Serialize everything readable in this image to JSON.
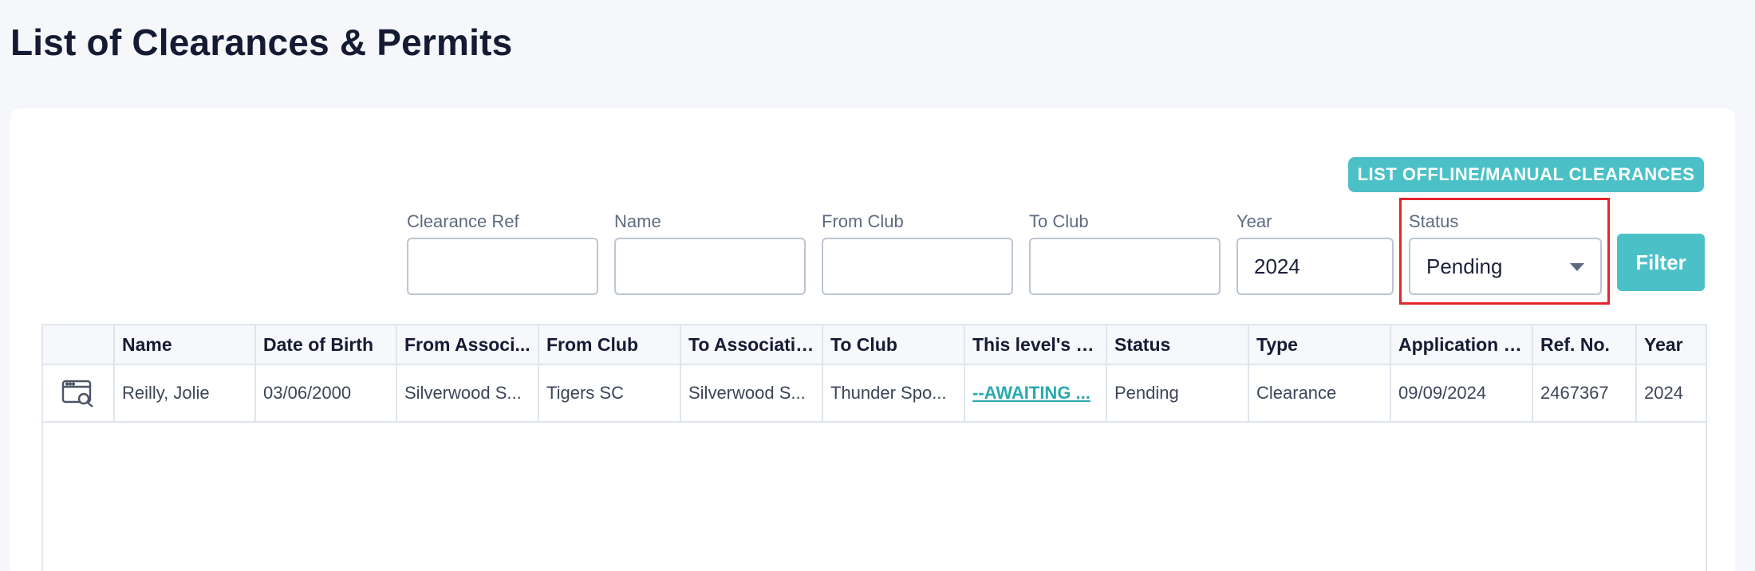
{
  "page": {
    "title": "List of Clearances & Permits"
  },
  "toolbar": {
    "offline_button": "LIST OFFLINE/MANUAL CLEARANCES",
    "filter_button": "Filter"
  },
  "filters": {
    "clearance_ref": {
      "label": "Clearance Ref",
      "value": ""
    },
    "name": {
      "label": "Name",
      "value": ""
    },
    "from_club": {
      "label": "From Club",
      "value": ""
    },
    "to_club": {
      "label": "To Club",
      "value": ""
    },
    "year": {
      "label": "Year",
      "value": "2024"
    },
    "status": {
      "label": "Status",
      "selected": "Pending"
    }
  },
  "table": {
    "columns": [
      "",
      "Name",
      "Date of Birth",
      "From Associ...",
      "From Club",
      "To Association",
      "To Club",
      "This level's st...",
      "Status",
      "Type",
      "Application D...",
      "Ref. No.",
      "Year"
    ],
    "rows": [
      {
        "icon": "view-record-icon",
        "name": "Reilly, Jolie",
        "dob": "03/06/2000",
        "from_association": "Silverwood S...",
        "from_club": "Tigers SC",
        "to_association": "Silverwood S...",
        "to_club": "Thunder Spo...",
        "level_status": "--AWAITING ...",
        "status": "Pending",
        "type": "Clearance",
        "application_date": "09/09/2024",
        "ref_no": "2467367",
        "year": "2024"
      }
    ]
  },
  "colors": {
    "accent": "#4bc1c7",
    "highlight": "#e3262d",
    "link": "#2aa9b0"
  }
}
